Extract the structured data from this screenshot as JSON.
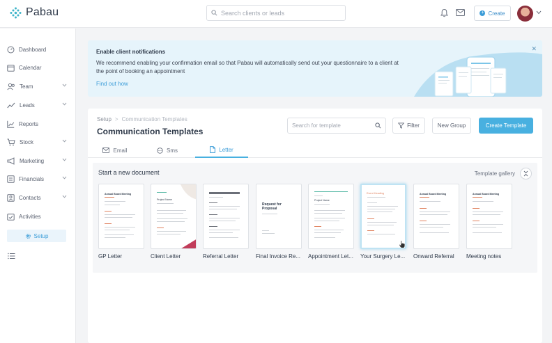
{
  "app": {
    "name": "Pabau"
  },
  "topbar": {
    "search_placeholder": "Search clients or leads",
    "create_label": "Create"
  },
  "sidebar": {
    "items": [
      {
        "label": "Dashboard",
        "icon": "dashboard-icon",
        "has_chevron": false
      },
      {
        "label": "Calendar",
        "icon": "calendar-icon",
        "has_chevron": false
      },
      {
        "label": "Team",
        "icon": "team-icon",
        "has_chevron": true
      },
      {
        "label": "Leads",
        "icon": "leads-icon",
        "has_chevron": true
      },
      {
        "label": "Reports",
        "icon": "reports-icon",
        "has_chevron": false
      },
      {
        "label": "Stock",
        "icon": "cart-icon",
        "has_chevron": true
      },
      {
        "label": "Marketing",
        "icon": "megaphone-icon",
        "has_chevron": true
      },
      {
        "label": "Financials",
        "icon": "financials-icon",
        "has_chevron": true
      },
      {
        "label": "Contacts",
        "icon": "contacts-icon",
        "has_chevron": true
      },
      {
        "label": "Activities",
        "icon": "activities-icon",
        "has_chevron": false
      }
    ],
    "setup_label": "Setup"
  },
  "banner": {
    "title": "Enable client notifications",
    "text": "We recommend enabling your confirmation email so that Pabau will automatically send out your questionnaire to a client at the point of booking an appointment",
    "link": "Find out how"
  },
  "main": {
    "breadcrumb": {
      "parent": "Setup",
      "separator": ">",
      "current": "Communication Templates"
    },
    "title": "Communication Templates",
    "search_placeholder": "Search for template",
    "filter_label": "Filter",
    "new_group_label": "New Group",
    "create_template_label": "Create Template",
    "tabs": [
      {
        "label": "Email",
        "icon": "mail-icon",
        "active": false
      },
      {
        "label": "Sms",
        "icon": "chat-icon",
        "active": false
      },
      {
        "label": "Letter",
        "icon": "document-icon",
        "active": true
      }
    ],
    "start_heading": "Start a new document",
    "gallery_label": "Template gallery",
    "templates": [
      {
        "label": "GP Letter",
        "heading": "Annual Board Meeting"
      },
      {
        "label": "Client Letter",
        "heading": "Project Name"
      },
      {
        "label": "Referral Letter",
        "heading": ""
      },
      {
        "label": "Final Invoice Re...",
        "heading": "Request for Proposal"
      },
      {
        "label": "Appointment Let...",
        "heading": "Project Name"
      },
      {
        "label": "Your Surgery Le...",
        "heading": "Event Heading"
      },
      {
        "label": "Onward Referral",
        "heading": "Annual Board Meeting"
      },
      {
        "label": "Meeting notes",
        "heading": "Annual Board Meeting"
      }
    ]
  },
  "colors": {
    "accent": "#48b0e0",
    "link": "#3c9dd8",
    "banner_bg": "#e6f4fb",
    "text_dark": "#2f3a4a"
  }
}
